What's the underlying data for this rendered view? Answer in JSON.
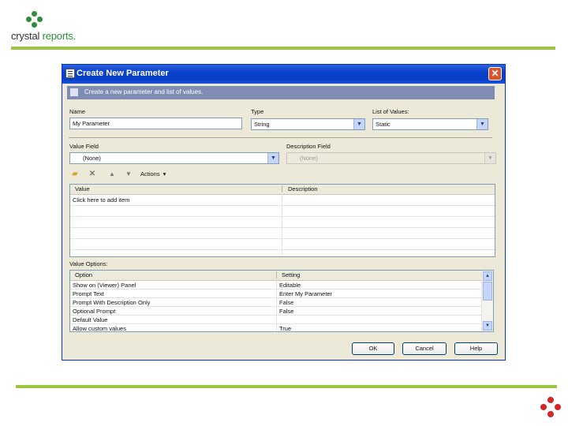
{
  "slide": {
    "logo": {
      "brand": "crystal",
      "product": "reports",
      "suffix": "."
    }
  },
  "dialog": {
    "title": "Create New Parameter",
    "banner": "Create a new parameter and list of values.",
    "name": {
      "label": "Name",
      "value": "My Parameter"
    },
    "type": {
      "label": "Type",
      "value": "String"
    },
    "list_of_values": {
      "label": "List of Values:",
      "value": "Static"
    },
    "value_field": {
      "label": "Value Field",
      "value": "(None)"
    },
    "description_field": {
      "label": "Description Field",
      "value": "(None)"
    },
    "toolbar": {
      "actions_label": "Actions",
      "actions_caret": "▾"
    },
    "values_grid": {
      "columns": [
        "Value",
        "Description"
      ],
      "rows": [
        {
          "value": "Click here to add item",
          "description": ""
        },
        {
          "value": "",
          "description": ""
        },
        {
          "value": "",
          "description": ""
        },
        {
          "value": "",
          "description": ""
        },
        {
          "value": "",
          "description": ""
        },
        {
          "value": "",
          "description": ""
        }
      ]
    },
    "value_options": {
      "label": "Value Options:",
      "columns": [
        "Option",
        "Setting"
      ],
      "rows": [
        {
          "option": "Show on (Viewer) Panel",
          "setting": "Editable"
        },
        {
          "option": "Prompt Text",
          "setting": "Enter My Parameter"
        },
        {
          "option": "Prompt With Description Only",
          "setting": "False"
        },
        {
          "option": "Optional Prompt",
          "setting": "False"
        },
        {
          "option": "Default Value",
          "setting": ""
        },
        {
          "option": "Allow custom values",
          "setting": "True"
        }
      ]
    },
    "buttons": {
      "ok": "OK",
      "cancel": "Cancel",
      "help": "Help"
    }
  },
  "icons": {
    "title": "parameter-icon",
    "close": "close-icon",
    "add": "folder-add-icon",
    "delete": "delete-icon",
    "up": "arrow-up-icon",
    "down": "arrow-down-icon"
  },
  "colors": {
    "titlebar": "#0a3fc8",
    "banner": "#7f8db4",
    "accent_line": "#9ac640",
    "logo_green": "#2f8d3a",
    "corner_red": "#d4252b"
  }
}
